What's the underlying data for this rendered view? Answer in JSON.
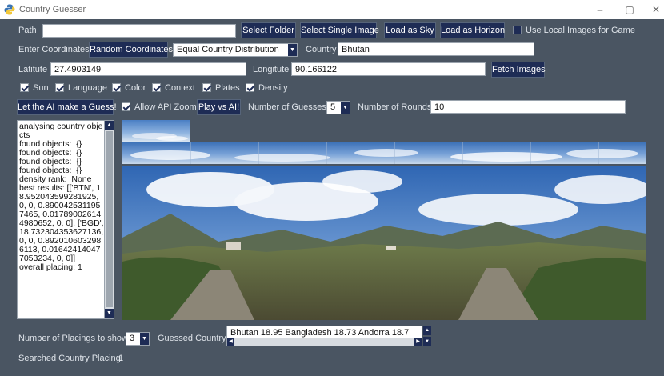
{
  "window": {
    "title": "Country Guesser",
    "minimize": "–",
    "maximize": "▢",
    "close": "✕"
  },
  "path_row": {
    "label": "Path",
    "value": "",
    "select_folder": "Select Folder",
    "select_single_image": "Select Single Image",
    "load_as_sky": "Load as Sky",
    "load_as_horizon": "Load as Horizon",
    "use_local_images_label": "Use Local Images for Game"
  },
  "coords_row": {
    "label": "Enter Coordinates",
    "random_button": "Random Coordinates",
    "distribution_selected": "Equal Country Distribution",
    "country_label": "Country",
    "country_value": "Bhutan"
  },
  "latlon_row": {
    "latitude_label": "Latitute",
    "latitude_value": "27.4903149",
    "longitude_label": "Longitute",
    "longitude_value": "90.166122",
    "fetch_button": "Fetch Images"
  },
  "features": [
    {
      "label": "Sun",
      "checked": true
    },
    {
      "label": "Language",
      "checked": true
    },
    {
      "label": "Color",
      "checked": true
    },
    {
      "label": "Context",
      "checked": true
    },
    {
      "label": "Plates",
      "checked": true
    },
    {
      "label": "Density",
      "checked": true
    }
  ],
  "ai_row": {
    "guess_button": "Let the AI make a Guess!",
    "allow_api_zoom_label": "Allow API Zoom",
    "play_vs_ai_button": "Play vs AI!",
    "num_guesses_label": "Number of Guesses:",
    "num_guesses_value": "5",
    "num_rounds_label": "Number of Rounds:",
    "num_rounds_value": "10"
  },
  "log": {
    "text": "analysing country objects\nfound objects:  {}\nfound objects:  {}\nfound objects:  {}\nfound objects:  {}\ndensity rank:  None\nbest results: [['BTN', 18.952043599281925, 0, 0, 0.8900425311957465, 0.017890026144980652, 0, 0], ['BGD', 18.732304353627136, 0, 0, 0.8920106032986113, 0.016424140477053234, 0, 0]]\noverall placing: 1"
  },
  "bottom": {
    "placings_label": "Number of Placings to show:",
    "placings_value": "3",
    "guessed_country_label": "Guessed Country:",
    "guessed_country_value": "Bhutan 18.95 Bangladesh 18.73 Andorra 18.7",
    "searched_placing_label": "Searched Country Placing",
    "searched_placing_value": "1"
  },
  "colors": {
    "background": "#4a5562",
    "button": "#1e2c55",
    "entry": "#ffffff"
  }
}
